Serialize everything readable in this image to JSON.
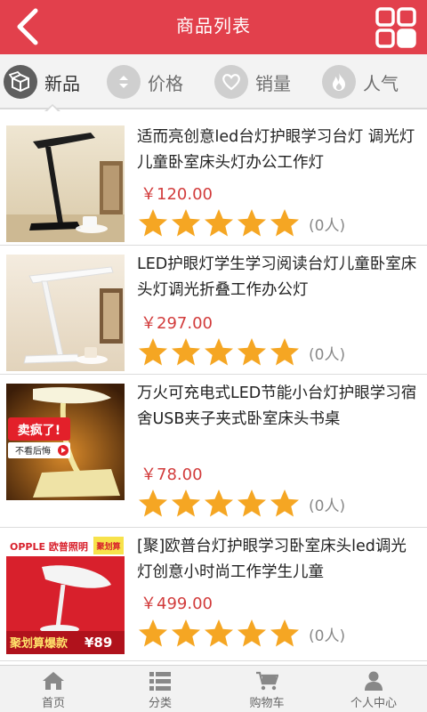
{
  "header": {
    "title": "商品列表",
    "back_icon": "chevron-left-icon",
    "grid_icon": "grid-view-icon",
    "background": "#e2404c"
  },
  "sort_tabs": [
    {
      "label": "新品",
      "icon": "box-icon",
      "active": true
    },
    {
      "label": "价格",
      "icon": "sort-arrows-icon",
      "active": false
    },
    {
      "label": "销量",
      "icon": "heart-icon",
      "active": false
    },
    {
      "label": "人气",
      "icon": "flame-icon",
      "active": false
    }
  ],
  "products": [
    {
      "title": "适而亮创意led台灯护眼学习台灯 调光灯儿童卧室床头灯办公工作灯",
      "price": "￥120.00",
      "rating_stars": 5,
      "review_count": "(0人)",
      "image": "black-desk-lamp"
    },
    {
      "title": "LED护眼灯学生学习阅读台灯儿童卧室床头灯调光折叠工作办公灯",
      "price": "￥297.00",
      "rating_stars": 5,
      "review_count": "(0人)",
      "image": "white-desk-lamp"
    },
    {
      "title": "万火可充电式LED节能小台灯护眼学习宿舍USB夹子夹式卧室床头书桌",
      "price": "￥78.00",
      "rating_stars": 5,
      "review_count": "(0人)",
      "image": "yellow-clip-lamp",
      "image_text": {
        "headline": "卖疯了!",
        "sub": "不看后悔"
      }
    },
    {
      "title": "[聚]欧普台灯护眼学习卧室床头led调光灯创意小时尚工作学生儿童",
      "price": "￥499.00",
      "rating_stars": 5,
      "review_count": "(0人)",
      "image": "opple-white-lamp",
      "image_text": {
        "brand": "OPPLE 欧普照明",
        "badge": "聚划算",
        "banner": "聚划算爆款",
        "banner_price": "¥89"
      }
    }
  ],
  "bottom_nav": [
    {
      "label": "首页",
      "icon": "home-icon"
    },
    {
      "label": "分类",
      "icon": "list-icon"
    },
    {
      "label": "购物车",
      "icon": "cart-icon"
    },
    {
      "label": "个人中心",
      "icon": "user-icon"
    }
  ],
  "colors": {
    "accent": "#e2404c",
    "price": "#d23c3c",
    "star": "#f5a623"
  }
}
